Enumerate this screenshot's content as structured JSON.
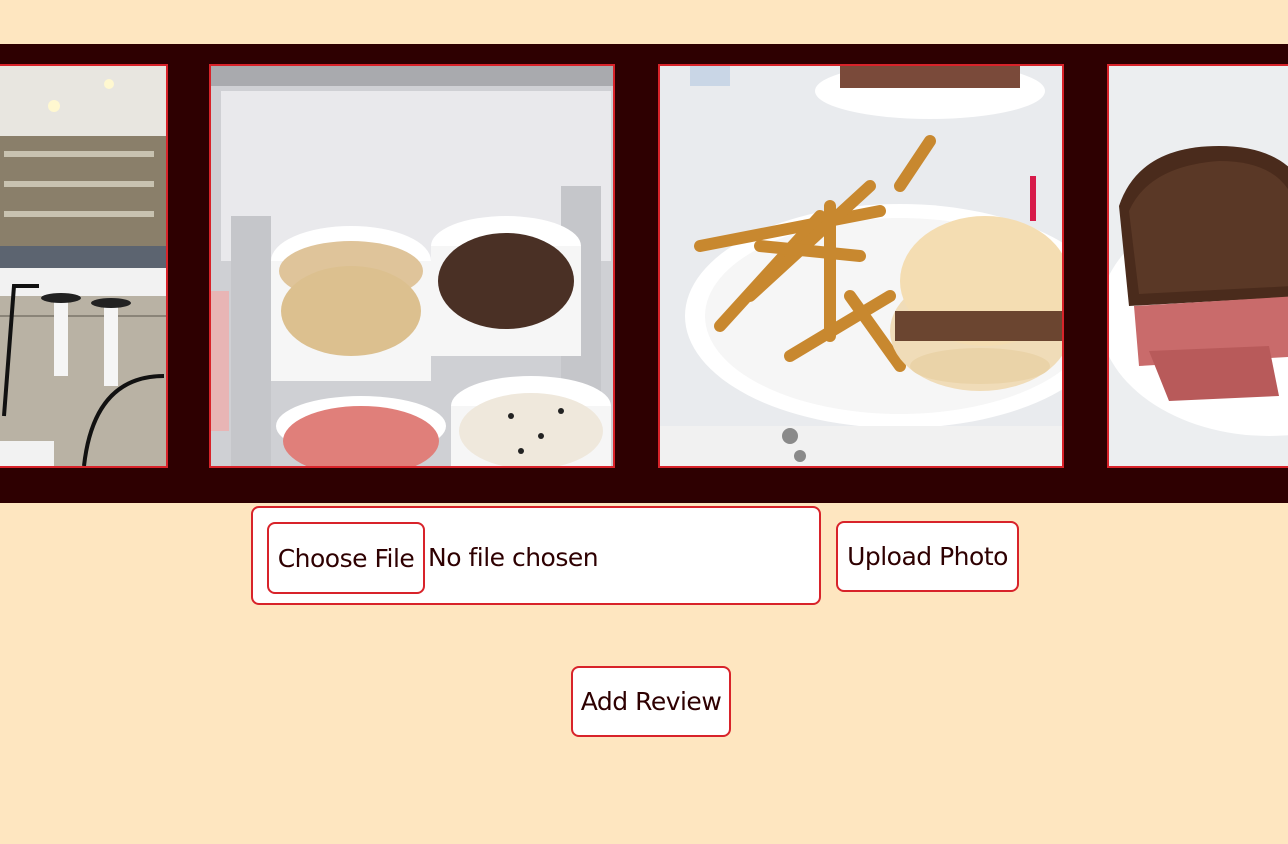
{
  "gallery": {
    "photos": [
      {
        "name": "diner-interior-photo",
        "description_icon": "diner-counter-image"
      },
      {
        "name": "ice-cream-tubs-photo",
        "description_icon": "ice-cream-image"
      },
      {
        "name": "burger-fries-photo",
        "description_icon": "burger-plate-image"
      },
      {
        "name": "reuben-sandwich-photo",
        "description_icon": "sandwich-image"
      }
    ],
    "frame_color": "#d8232a",
    "background_color": "#2e0001"
  },
  "upload": {
    "choose_file_label": "Choose File",
    "no_file_text": "No file chosen",
    "upload_button_label": "Upload Photo"
  },
  "review": {
    "add_review_label": "Add Review"
  },
  "colors": {
    "page_background": "#fee6c0",
    "accent": "#d8232a",
    "text": "#2e0001"
  }
}
